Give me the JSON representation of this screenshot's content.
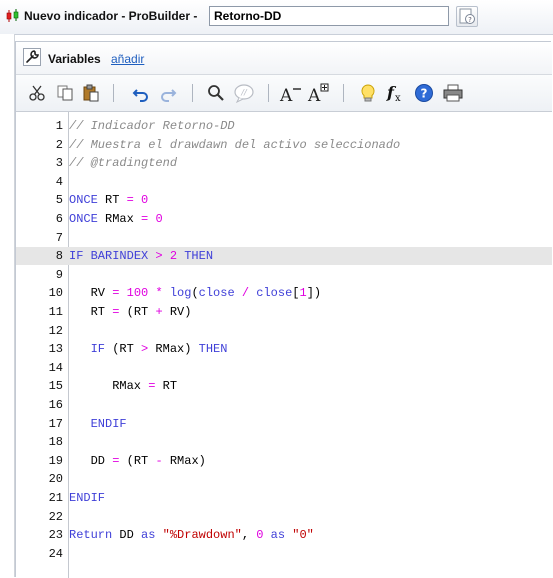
{
  "window": {
    "title": "Nuevo indicador - ProBuilder  -",
    "name_value": "Retorno-DD"
  },
  "variables_bar": {
    "label": "Variables",
    "add_link": "añadir"
  },
  "toolbar": {
    "buttons": [
      "cut-icon",
      "copy-icon",
      "paste-icon",
      "undo-icon",
      "redo-icon",
      "search-icon",
      "comment-icon",
      "font-decrease-icon",
      "font-increase-icon",
      "lightbulb-icon",
      "function-icon",
      "help-icon",
      "print-icon"
    ]
  },
  "colors": {
    "keyword": "#4040d8",
    "number": "#e000e0",
    "comment": "#8a8a8a",
    "string": "#c00000",
    "highlight_line": "#e6e6e6"
  },
  "editor": {
    "highlighted_line": 8,
    "lines": [
      {
        "n": "1",
        "tokens": [
          {
            "t": "// Indicador Retorno-DD",
            "c": "cm"
          }
        ]
      },
      {
        "n": "2",
        "tokens": [
          {
            "t": "// Muestra el drawdawn del activo seleccionado",
            "c": "cm"
          }
        ]
      },
      {
        "n": "3",
        "tokens": [
          {
            "t": "// @tradingtend",
            "c": "cm"
          }
        ]
      },
      {
        "n": "4",
        "tokens": []
      },
      {
        "n": "5",
        "tokens": [
          {
            "t": "ONCE",
            "c": "kw"
          },
          {
            "t": " RT ",
            "c": "id"
          },
          {
            "t": "=",
            "c": "op"
          },
          {
            "t": " ",
            "c": "id"
          },
          {
            "t": "0",
            "c": "num"
          }
        ]
      },
      {
        "n": "6",
        "tokens": [
          {
            "t": "ONCE",
            "c": "kw"
          },
          {
            "t": " RMax ",
            "c": "id"
          },
          {
            "t": "=",
            "c": "op"
          },
          {
            "t": " ",
            "c": "id"
          },
          {
            "t": "0",
            "c": "num"
          }
        ]
      },
      {
        "n": "7",
        "tokens": []
      },
      {
        "n": "8",
        "tokens": [
          {
            "t": "IF",
            "c": "kw"
          },
          {
            "t": " ",
            "c": "id"
          },
          {
            "t": "BARINDEX",
            "c": "kw"
          },
          {
            "t": " ",
            "c": "id"
          },
          {
            "t": ">",
            "c": "op"
          },
          {
            "t": " ",
            "c": "id"
          },
          {
            "t": "2",
            "c": "num"
          },
          {
            "t": " ",
            "c": "id"
          },
          {
            "t": "THEN",
            "c": "kw"
          }
        ]
      },
      {
        "n": "9",
        "tokens": []
      },
      {
        "n": "10",
        "tokens": [
          {
            "t": "   RV ",
            "c": "id"
          },
          {
            "t": "=",
            "c": "op"
          },
          {
            "t": " ",
            "c": "id"
          },
          {
            "t": "100",
            "c": "num"
          },
          {
            "t": " ",
            "c": "id"
          },
          {
            "t": "*",
            "c": "op"
          },
          {
            "t": " ",
            "c": "id"
          },
          {
            "t": "log",
            "c": "kw"
          },
          {
            "t": "(",
            "c": "id"
          },
          {
            "t": "close",
            "c": "kw"
          },
          {
            "t": " ",
            "c": "id"
          },
          {
            "t": "/",
            "c": "op"
          },
          {
            "t": " ",
            "c": "id"
          },
          {
            "t": "close",
            "c": "kw"
          },
          {
            "t": "[",
            "c": "id"
          },
          {
            "t": "1",
            "c": "num"
          },
          {
            "t": "])",
            "c": "id"
          }
        ]
      },
      {
        "n": "11",
        "tokens": [
          {
            "t": "   RT ",
            "c": "id"
          },
          {
            "t": "=",
            "c": "op"
          },
          {
            "t": " (RT ",
            "c": "id"
          },
          {
            "t": "+",
            "c": "op"
          },
          {
            "t": " RV)",
            "c": "id"
          }
        ]
      },
      {
        "n": "12",
        "tokens": []
      },
      {
        "n": "13",
        "tokens": [
          {
            "t": "   ",
            "c": "id"
          },
          {
            "t": "IF",
            "c": "kw"
          },
          {
            "t": " (RT ",
            "c": "id"
          },
          {
            "t": ">",
            "c": "op"
          },
          {
            "t": " RMax) ",
            "c": "id"
          },
          {
            "t": "THEN",
            "c": "kw"
          }
        ]
      },
      {
        "n": "14",
        "tokens": []
      },
      {
        "n": "15",
        "tokens": [
          {
            "t": "      RMax ",
            "c": "id"
          },
          {
            "t": "=",
            "c": "op"
          },
          {
            "t": " RT",
            "c": "id"
          }
        ]
      },
      {
        "n": "16",
        "tokens": []
      },
      {
        "n": "17",
        "tokens": [
          {
            "t": "   ",
            "c": "id"
          },
          {
            "t": "ENDIF",
            "c": "kw"
          }
        ]
      },
      {
        "n": "18",
        "tokens": []
      },
      {
        "n": "19",
        "tokens": [
          {
            "t": "   DD ",
            "c": "id"
          },
          {
            "t": "=",
            "c": "op"
          },
          {
            "t": " (RT ",
            "c": "id"
          },
          {
            "t": "-",
            "c": "op"
          },
          {
            "t": " RMax)",
            "c": "id"
          }
        ]
      },
      {
        "n": "20",
        "tokens": []
      },
      {
        "n": "21",
        "tokens": [
          {
            "t": "ENDIF",
            "c": "kw"
          }
        ]
      },
      {
        "n": "22",
        "tokens": []
      },
      {
        "n": "23",
        "tokens": [
          {
            "t": "Return",
            "c": "kw"
          },
          {
            "t": " DD ",
            "c": "id"
          },
          {
            "t": "as",
            "c": "kw"
          },
          {
            "t": " ",
            "c": "id"
          },
          {
            "t": "\"%Drawdown\"",
            "c": "str"
          },
          {
            "t": ", ",
            "c": "id"
          },
          {
            "t": "0",
            "c": "num"
          },
          {
            "t": " ",
            "c": "id"
          },
          {
            "t": "as",
            "c": "kw"
          },
          {
            "t": " ",
            "c": "id"
          },
          {
            "t": "\"0\"",
            "c": "str"
          }
        ]
      },
      {
        "n": "24",
        "tokens": []
      }
    ]
  }
}
